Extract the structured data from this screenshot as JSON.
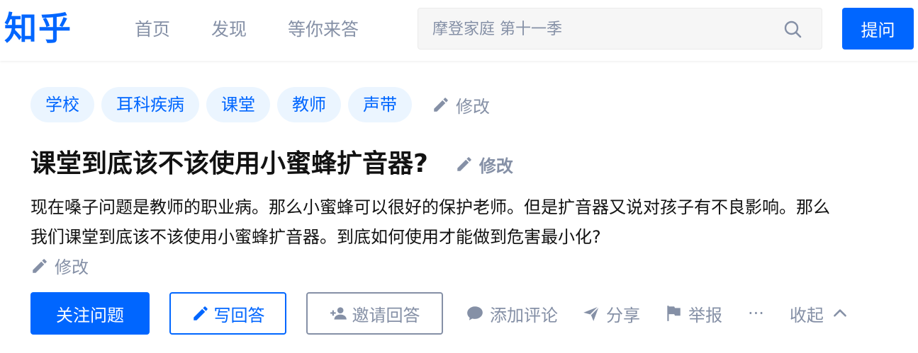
{
  "header": {
    "logo": "知乎",
    "nav": [
      "首页",
      "发现",
      "等你来答"
    ],
    "search_placeholder": "摩登家庭 第十一季",
    "ask_label": "提问"
  },
  "topics": [
    "学校",
    "耳科疾病",
    "课堂",
    "教师",
    "声带"
  ],
  "edit_label": "修改",
  "question": {
    "title": "课堂到底该不该使用小蜜蜂扩音器?",
    "description": "现在嗓子问题是教师的职业病。那么小蜜蜂可以很好的保护老师。但是扩音器又说对孩子有不良影响。那么我们课堂到底该不该使用小蜜蜂扩音器。到底如何使用才能做到危害最小化?"
  },
  "actions": {
    "follow": "关注问题",
    "write": "写回答",
    "invite": "邀请回答",
    "comment": "添加评论",
    "share": "分享",
    "report": "举报",
    "more": "···",
    "collapse": "收起"
  },
  "colors": {
    "brand": "#0066ff",
    "muted": "#8590a6",
    "topic_bg": "#ebf5ff"
  }
}
